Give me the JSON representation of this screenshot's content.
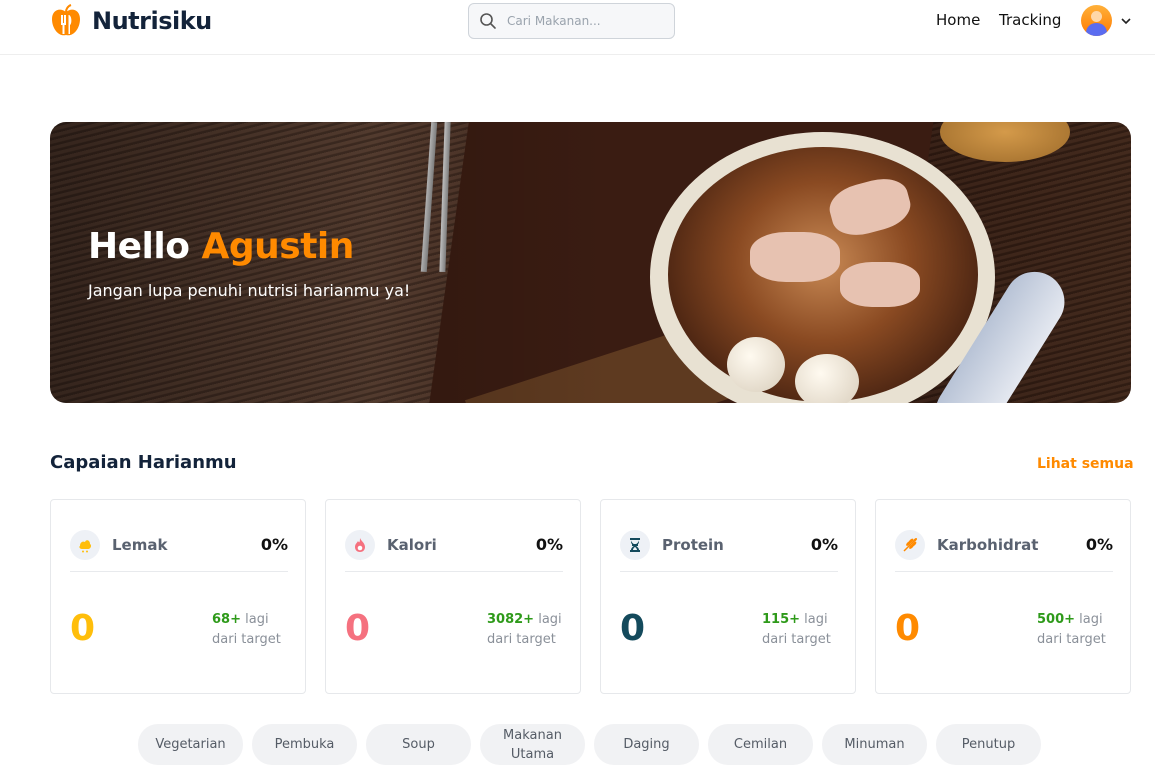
{
  "app": {
    "name": "Nutrisiku"
  },
  "search": {
    "placeholder": "Cari Makanan..."
  },
  "nav": {
    "home": "Home",
    "tracking": "Tracking"
  },
  "hero": {
    "greeting": "Hello",
    "user_name": "Agustin",
    "subtitle": "Jangan lupa penuhi nutrisi harianmu ya!"
  },
  "achievements": {
    "title": "Capaian Harianmu",
    "see_all": "Lihat semua",
    "cards": [
      {
        "label": "Lemak",
        "percent": "0%",
        "value": "0",
        "remaining": "68+",
        "suffix": "lagi",
        "note": "dari target",
        "color": "#ffbe0b",
        "icon": "fat-icon"
      },
      {
        "label": "Kalori",
        "percent": "0%",
        "value": "0",
        "remaining": "3082+",
        "suffix": "lagi",
        "note": "dari target",
        "color": "#f5717f",
        "icon": "fire-icon"
      },
      {
        "label": "Protein",
        "percent": "0%",
        "value": "0",
        "remaining": "115+",
        "suffix": "lagi",
        "note": "dari target",
        "color": "#144a5c",
        "icon": "dna-icon"
      },
      {
        "label": "Karbohidrat",
        "percent": "0%",
        "value": "0",
        "remaining": "500+",
        "suffix": "lagi",
        "note": "dari target",
        "color": "#ff8a00",
        "icon": "wheat-icon"
      }
    ]
  },
  "categories": [
    "Vegetarian",
    "Pembuka",
    "Soup",
    "Makanan Utama",
    "Daging",
    "Cemilan",
    "Minuman",
    "Penutup"
  ],
  "colors": {
    "accent": "#ff8a00",
    "brand_text": "#13233a",
    "remaining_green": "#2e9a1a"
  }
}
